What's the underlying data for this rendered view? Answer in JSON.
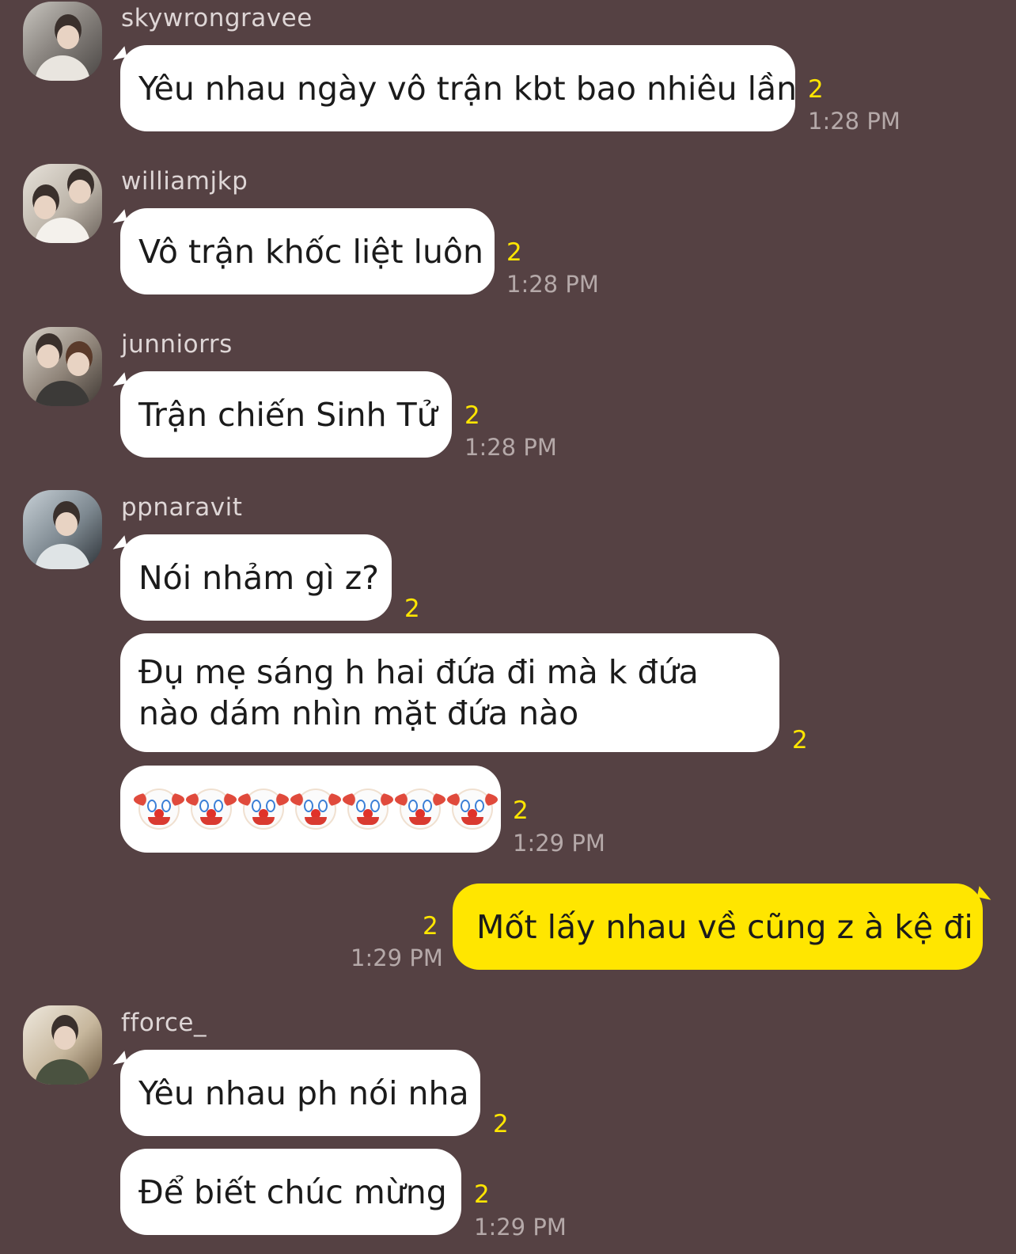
{
  "messages": [
    {
      "user": "skywrongravee",
      "text": "Yêu nhau ngày vô trận kbt bao nhiêu lần",
      "count": "2",
      "time": "1:28 PM"
    },
    {
      "user": "williamjkp",
      "text": "Vô trận khốc liệt luôn",
      "count": "2",
      "time": "1:28 PM"
    },
    {
      "user": "junniorrs",
      "text": "Trận chiến Sinh Tử",
      "count": "2",
      "time": "1:28 PM"
    },
    {
      "user": "ppnaravit",
      "text": "Nói nhảm gì z?",
      "count": "2",
      "time": ""
    },
    {
      "user": "",
      "text": "Đụ mẹ sáng h hai đứa đi mà k đứa nào dám nhìn mặt đứa nào",
      "count": "2",
      "time": ""
    },
    {
      "user": "",
      "text": "🤡🤡🤡🤡🤡🤡🤡",
      "count": "2",
      "time": "1:29 PM"
    },
    {
      "user": "",
      "text": "Mốt lấy nhau về cũng z à kệ đi",
      "count": "2",
      "time": "1:29 PM",
      "mine": true
    },
    {
      "user": "fforce_",
      "text": "Yêu nhau ph nói nha",
      "count": "2",
      "time": ""
    },
    {
      "user": "",
      "text": "Để biết chúc mừng",
      "count": "2",
      "time": "1:29 PM"
    }
  ],
  "icons": {
    "clown": "clown-face-emoji",
    "avatar": "user-avatar"
  },
  "colors": {
    "background": "#554143",
    "my_bubble": "#ffe600",
    "other_bubble": "#ffffff",
    "unread_count": "#ffe600"
  }
}
